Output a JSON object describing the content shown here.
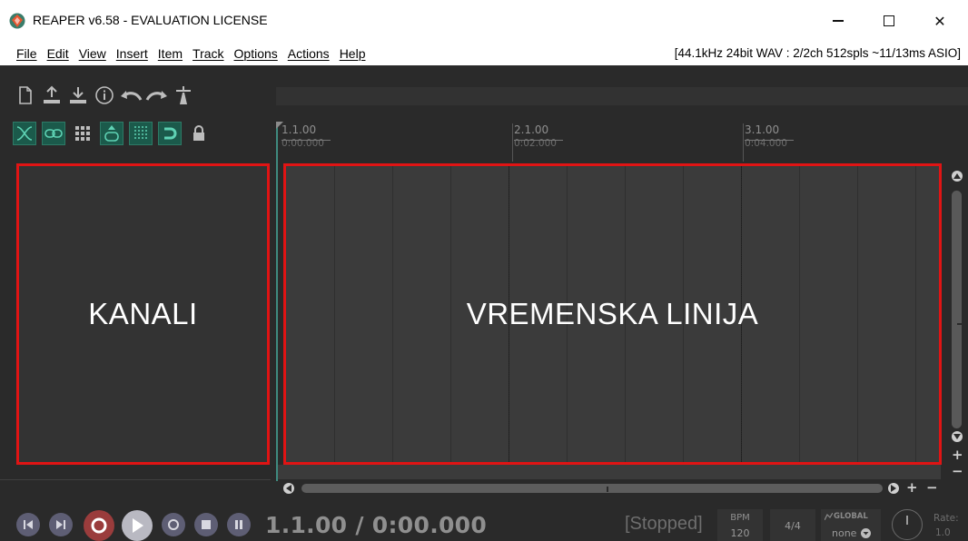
{
  "window": {
    "title": "REAPER v6.58 - EVALUATION LICENSE",
    "close_glyph": "✕"
  },
  "menu": {
    "items": [
      "File",
      "Edit",
      "View",
      "Insert",
      "Item",
      "Track",
      "Options",
      "Actions",
      "Help"
    ],
    "audio_info": "[44.1kHz 24bit WAV : 2/2ch 512spls ~11/13ms ASIO]"
  },
  "toolbar": {
    "icons": [
      "new-project-icon",
      "open-project-icon",
      "save-project-icon",
      "project-settings-icon",
      "undo-icon",
      "redo-icon",
      "metronome-icon"
    ],
    "toggles": [
      "ripple-edit-icon",
      "auto-crossfade-icon",
      "grid-icon",
      "snap-icon",
      "locking-icon",
      "loop-icon",
      "lock-icon"
    ]
  },
  "ruler": {
    "marks": [
      {
        "bar": "1.1.00",
        "time": "0:00.000"
      },
      {
        "bar": "2.1.00",
        "time": "0:02.000"
      },
      {
        "bar": "3.1.00",
        "time": "0:04.000"
      }
    ]
  },
  "panels": {
    "tracks_label": "KANALI",
    "timeline_label": "VREMENSKA LINIJA"
  },
  "transport": {
    "position": "1.1.00 / 0:00.000",
    "status": "[Stopped]",
    "bpm_label": "BPM",
    "bpm_value": "120",
    "time_signature": "4/4",
    "global_label": "GLOBAL",
    "global_value": "none",
    "rate_label": "Rate:",
    "rate_value": "1.0"
  },
  "colors": {
    "accent_red": "#e01414",
    "toggle_green": "#1b5a4b",
    "record": "#9a3c3c"
  }
}
